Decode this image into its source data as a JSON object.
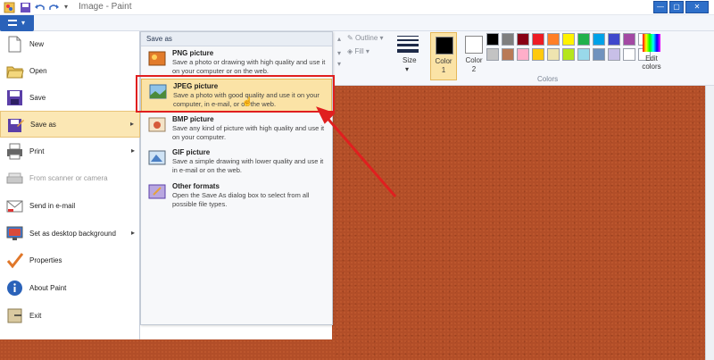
{
  "window": {
    "title": "Image - Paint",
    "buttons": [
      "—",
      "▢",
      "✕"
    ]
  },
  "file_menu": {
    "items": [
      {
        "label": "New",
        "icon": "new-file-icon"
      },
      {
        "label": "Open",
        "icon": "open-folder-icon"
      },
      {
        "label": "Save",
        "icon": "floppy-disk-icon"
      },
      {
        "label": "Save as",
        "icon": "save-as-icon",
        "has_submenu": true,
        "selected": true
      },
      {
        "label": "Print",
        "icon": "printer-icon",
        "has_submenu": true
      },
      {
        "label": "From scanner or camera",
        "icon": "scanner-icon",
        "disabled": true
      },
      {
        "label": "Send in e-mail",
        "icon": "email-icon"
      },
      {
        "label": "Set as desktop background",
        "icon": "desktop-icon",
        "has_submenu": true
      },
      {
        "label": "Properties",
        "icon": "checkmark-icon"
      },
      {
        "label": "About Paint",
        "icon": "info-icon"
      },
      {
        "label": "Exit",
        "icon": "exit-icon"
      }
    ]
  },
  "save_as": {
    "header": "Save as",
    "options": [
      {
        "title": "PNG picture",
        "desc": "Save a photo or drawing with high quality and use it on your computer or on the web.",
        "icon": "png-icon"
      },
      {
        "title": "JPEG picture",
        "desc": "Save a photo with good quality and use it on your computer, in e-mail, or on the web.",
        "icon": "jpeg-icon",
        "selected": true
      },
      {
        "title": "BMP picture",
        "desc": "Save any kind of picture with high quality and use it on your computer.",
        "icon": "bmp-icon"
      },
      {
        "title": "GIF picture",
        "desc": "Save a simple drawing with lower quality and use it in e-mail or on the web.",
        "icon": "gif-icon"
      },
      {
        "title": "Other formats",
        "desc": "Open the Save As dialog box to select from all possible file types.",
        "icon": "other-formats-icon"
      }
    ]
  },
  "ribbon": {
    "outline_label": "Outline",
    "fill_label": "Fill",
    "size_label": "Size",
    "color1_label": "Color",
    "color1_num": "1",
    "color2_label": "Color",
    "color2_num": "2",
    "colors_group_label": "Colors",
    "edit_colors_label": "Edit",
    "edit_colors_label2": "colors",
    "color1_value": "#000000",
    "color2_value": "#ffffff",
    "palette": [
      "#000000",
      "#7f7f7f",
      "#880015",
      "#ed1c24",
      "#ff7f27",
      "#fff200",
      "#22b14c",
      "#00a2e8",
      "#3f48cc",
      "#a349a4",
      "#ffffff",
      "#c3c3c3",
      "#b97a57",
      "#ffaec9",
      "#ffc90e",
      "#efe4b0",
      "#b5e61d",
      "#99d9ea",
      "#7092be",
      "#c8bfe7",
      "#ffffff",
      "#ffffff"
    ]
  },
  "colors": {
    "accent": "#2a62b9",
    "highlight_border": "#e01f1f",
    "selection_fill": "#fbe3a6",
    "canvas": "#b24e28"
  }
}
